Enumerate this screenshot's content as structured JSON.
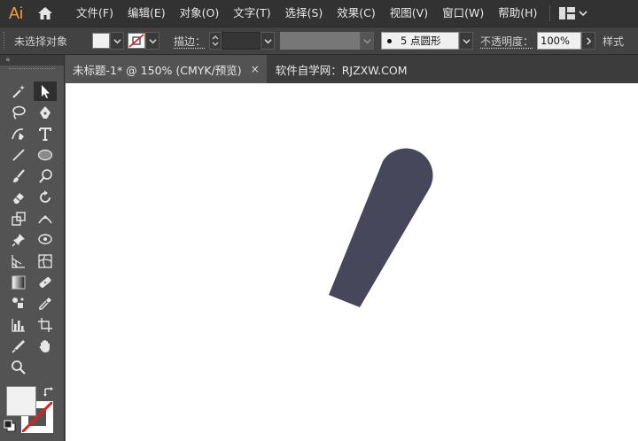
{
  "app": {
    "logo": "Ai"
  },
  "menu": [
    "文件(F)",
    "编辑(E)",
    "对象(O)",
    "文字(T)",
    "选择(S)",
    "效果(C)",
    "视图(V)",
    "窗口(W)",
    "帮助(H)"
  ],
  "control": {
    "selection_status": "未选择对象",
    "stroke_label": "描边：",
    "brush_label": "5 点圆形",
    "opacity_label": "不透明度：",
    "opacity_value": "100%",
    "style_label": "样式"
  },
  "tabs": [
    {
      "label": "未标题-1* @ 150% (CMYK/预览)",
      "close": "×"
    },
    {
      "label": "软件自学网：RJZXW.COM"
    }
  ],
  "tools_header": "«",
  "colors": {
    "shape_fill": "#47475c",
    "fill_swatch": "#f1f1f1",
    "accent_orange": "#f7a13b",
    "none_red": "#e02020"
  }
}
